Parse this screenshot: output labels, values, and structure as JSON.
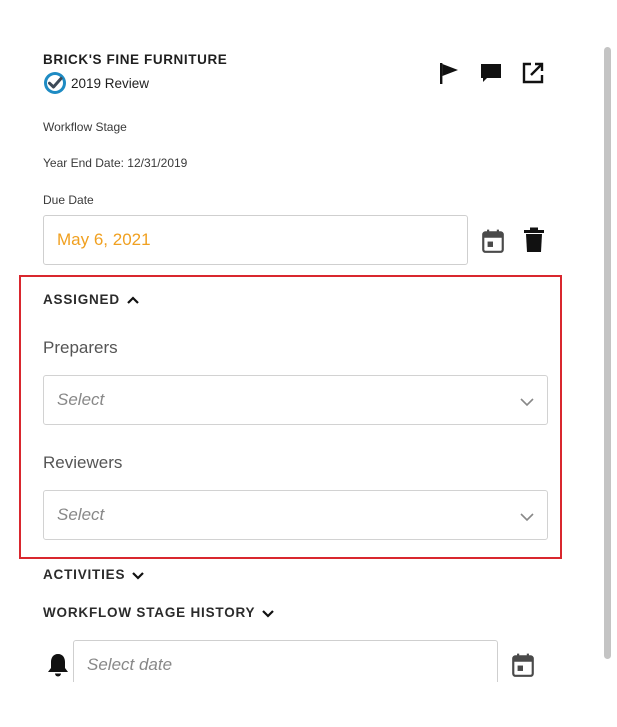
{
  "header": {
    "company": "BRICK'S FINE FURNITURE",
    "review_label": "2019 Review",
    "icons": [
      "flag-icon",
      "comment-icon",
      "external-link-icon"
    ]
  },
  "meta": {
    "workflow_stage_label": "Workflow Stage",
    "year_end_text": "Year End Date: 12/31/2019",
    "due_date_label": "Due Date"
  },
  "due_date": {
    "value": "May 6, 2021"
  },
  "assigned": {
    "heading": "ASSIGNED",
    "preparers_label": "Preparers",
    "preparers_placeholder": "Select",
    "reviewers_label": "Reviewers",
    "reviewers_placeholder": "Select"
  },
  "sections": {
    "activities": "ACTIVITIES",
    "workflow_history": "WORKFLOW STAGE HISTORY"
  },
  "reminder": {
    "placeholder": "Select date"
  },
  "colors": {
    "accent_orange": "#f0a020",
    "highlight_red": "#d9272e",
    "badge_blue": "#1e8bc3"
  }
}
